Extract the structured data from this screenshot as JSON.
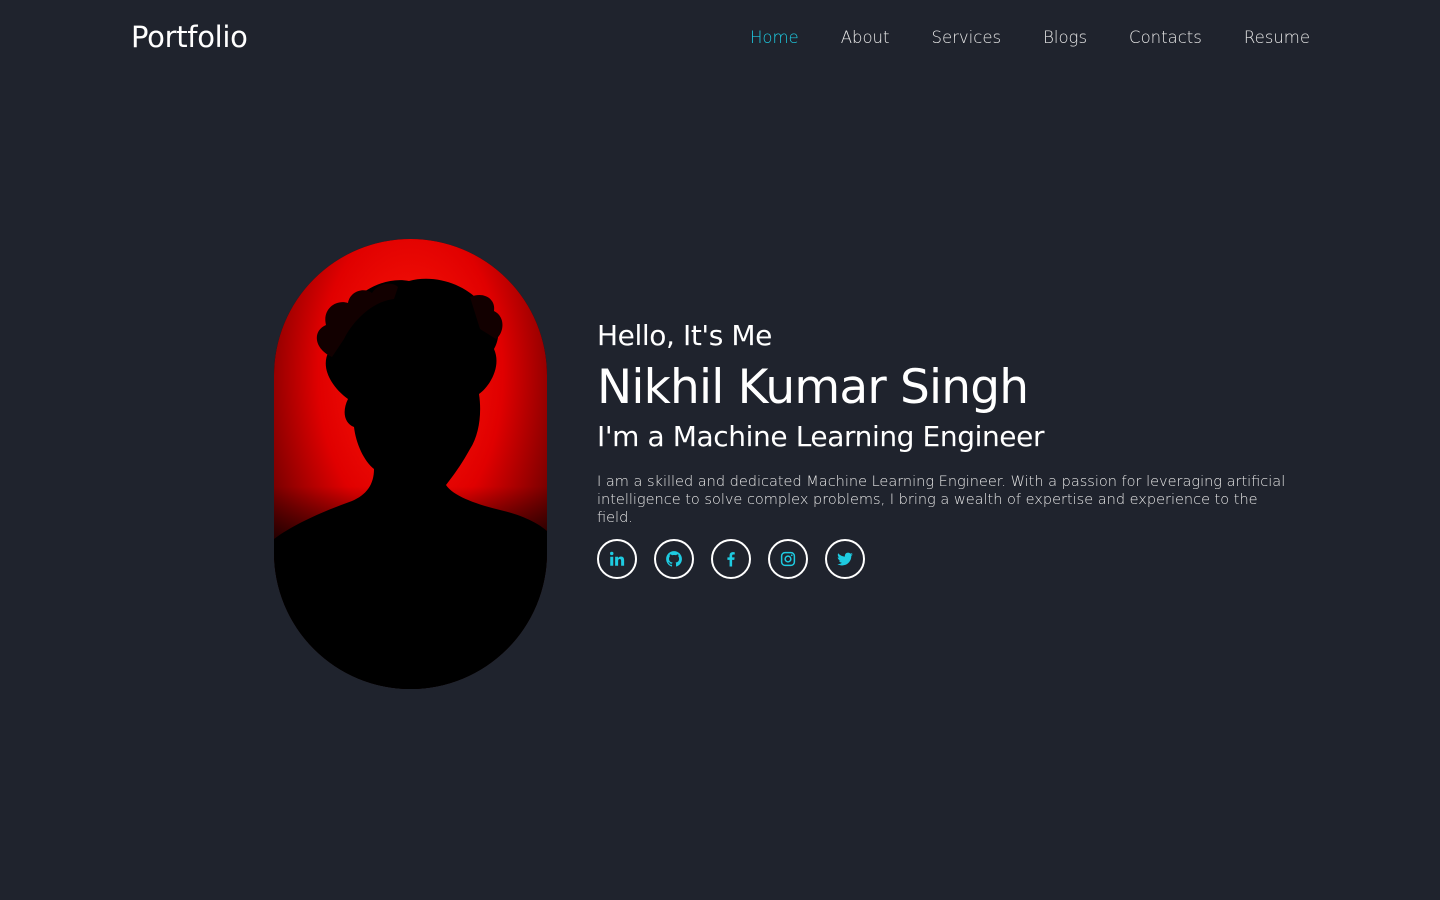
{
  "header": {
    "logo": "Portfolio",
    "nav": [
      {
        "label": "Home",
        "active": true
      },
      {
        "label": "About",
        "active": false
      },
      {
        "label": "Services",
        "active": false
      },
      {
        "label": "Blogs",
        "active": false
      },
      {
        "label": "Contacts",
        "active": false
      },
      {
        "label": "Resume",
        "active": false
      }
    ]
  },
  "hero": {
    "greeting": "Hello, It's Me",
    "name": "Nikhil Kumar Singh",
    "role": "I'm a Machine Learning Engineer",
    "bio": "I am a skilled and dedicated Machine Learning Engineer. With a passion for leveraging artificial intelligence to solve complex problems, I bring a wealth of expertise and experience to the field."
  },
  "social": [
    {
      "icon": "linkedin-icon"
    },
    {
      "icon": "github-icon"
    },
    {
      "icon": "facebook-icon"
    },
    {
      "icon": "instagram-icon"
    },
    {
      "icon": "twitter-icon"
    }
  ],
  "colors": {
    "background": "#1f232d",
    "accent": "#1ecbe1",
    "text": "#ffffff",
    "portrait_glow": "#ff0000"
  }
}
